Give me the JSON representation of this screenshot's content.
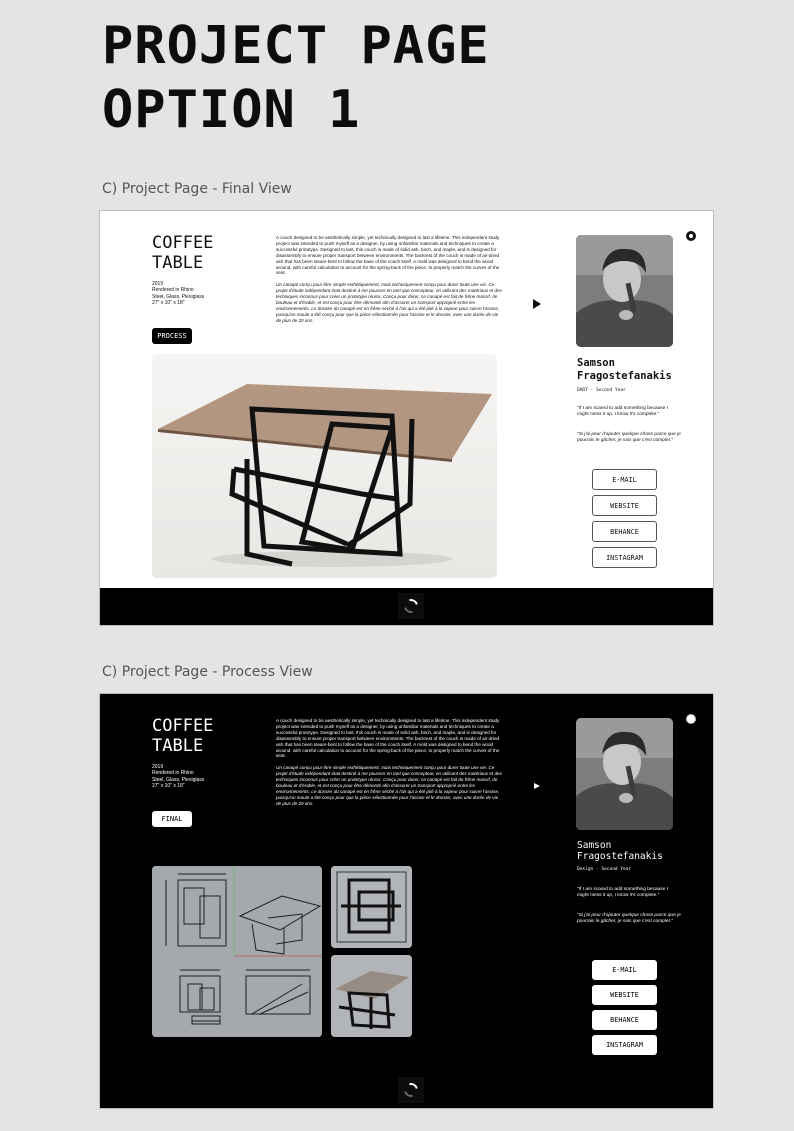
{
  "heading": {
    "line1": "PROJECT PAGE",
    "line2": "OPTION 1"
  },
  "final_view": {
    "section_label": "C) Project Page - Final View",
    "project": {
      "title_line1": "COFFEE",
      "title_line2": "TABLE",
      "year": "2019",
      "rendered": "Rendered in Rhino",
      "materials": "Steel, Glass, Plexiglass",
      "dimensions": "27\" x 10\" x 18\""
    },
    "mode_button": "PROCESS",
    "description_en": "A couch designed to be aesthetically simple, yet technically designed to last a lifetime. This independent study project was intended to push myself as a designer, by using unfamiliar materials and techniques to create a successful prototype. Designed to last, this couch is made of solid ash, birch, and maple, and is designed for disassembly to ensure proper transport between environments. The backrest of the couch is made of air-dried ash that has been steam-bent to follow the base of the couch itself. A mold was designed to bend the wood around, with careful calculation to account for the spring-back of the piece, to properly match the curves of the seat.",
    "description_fr": "Un canapé conçu pour être simple esthétiquement, mais techniquement conçu pour durer toute une vie. Ce projet d'étude indépendant était destiné à me pousser en tant que concepteur, en utilisant des matériaux et des techniques inconnus pour créer un prototype réussi. Conçu pour durer, ce canapé est fait de frêne massif, de bouleau et d'érable, et est conçu pour être démonté afin d'assurer un transport approprié entre les environnements. Le dossier du canapé est en frêne séché à l'air qui a été plié à la vapeur pour suivre l'assise, puisqu'un moule a été conçu pour que la pièce sélectionnée pour l'assise et le dossier, avec une durée de vie de plus de 20 ans.",
    "person": {
      "name_line1": "Samson",
      "name_line2": "Fragostefanakis",
      "program": "DART - Second Year",
      "quote_en": "\"If I am scared to add something because I might mess it up, I know it's complete.\"",
      "quote_fr": "\"Si j'ai peur d'ajouter quelque chose parce que je pourrais le gâcher, je sais que c'est complet.\""
    },
    "links": [
      "E-MAIL",
      "WEBSITE",
      "BEHANCE",
      "INSTAGRAM"
    ]
  },
  "process_view": {
    "section_label": "C) Project Page - Process View",
    "project": {
      "title_line1": "COFFEE",
      "title_line2": "TABLE",
      "year": "2019",
      "rendered": "Rendered in Rhino",
      "materials": "Steel, Glass, Plexiglass",
      "dimensions": "27\" x 10\" x 18\""
    },
    "mode_button": "FINAL",
    "description_en": "A couch designed to be aesthetically simple, yet technically designed to last a lifetime. This independent study project was intended to push myself as a designer, by using unfamiliar materials and techniques to create a successful prototype. Designed to last, this couch is made of solid ash, birch, and maple, and is designed for disassembly to ensure proper transport between environments. The backrest of the couch is made of air-dried ash that has been steam-bent to follow the base of the couch itself. A mold was designed to bend the wood around, with careful calculation to account for the spring-back of the piece, to properly match the curves of the seat.",
    "description_fr": "Un canapé conçu pour être simple esthétiquement, mais techniquement conçu pour durer toute une vie. Ce projet d'étude indépendant était destiné à me pousser en tant que concepteur, en utilisant des matériaux et des techniques inconnus pour créer un prototype réussi. Conçu pour durer, ce canapé est fait de frêne massif, de bouleau et d'érable, et est conçu pour être démonté afin d'assurer un transport approprié entre les environnements. Le dossier du canapé est en frêne séché à l'air qui a été plié à la vapeur pour suivre l'assise, puisqu'un moule a été conçu pour que la pièce sélectionnée pour l'assise et le dossier, avec une durée de vie de plus de 20 ans.",
    "person": {
      "name_line1": "Samson",
      "name_line2": "Fragostefanakis",
      "program": "Design - Second Year",
      "quote_en": "\"If I am scared to add something because I might mess it up, I know it's complete.\"",
      "quote_fr": "\"Si j'ai peur d'ajouter quelque chose parce que je pourrais le gâcher, je sais que c'est complet.\""
    },
    "links": [
      "E-MAIL",
      "WEBSITE",
      "BEHANCE",
      "INSTAGRAM"
    ]
  },
  "colors": {
    "background": "#e4e4e4",
    "light_page": "#ffffff",
    "dark_page": "#000000",
    "accent": "#000000"
  }
}
